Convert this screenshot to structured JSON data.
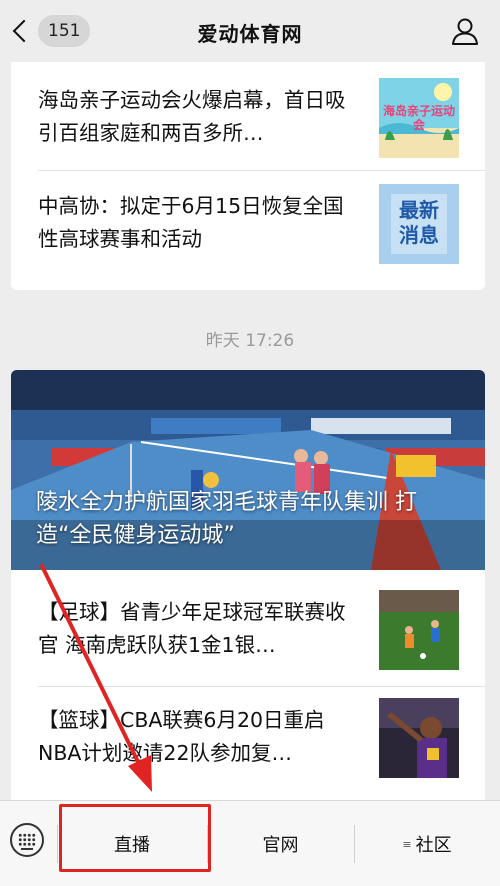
{
  "header": {
    "back_count": "151",
    "title": "爱动体育网"
  },
  "feed_top": {
    "items": [
      {
        "title": "海岛亲子运动会火爆启幕，首日吸引百组家庭和两百多所…",
        "thumb_text": "海岛亲子运动会"
      },
      {
        "title": "中高协：拟定于6月15日恢复全国性高球赛事和活动",
        "thumb_text": "最新消息"
      }
    ]
  },
  "timestamp": "昨天 17:26",
  "feed_main": {
    "hero_caption": "陵水全力护航国家羽毛球青年队集训 打造“全民健身运动城”",
    "items": [
      {
        "title": "【足球】省青少年足球冠军联赛收官 海南虎跃队获1金1银…"
      },
      {
        "title": "【篮球】CBA联赛6月20日重启 NBA计划邀请22队参加复…"
      }
    ]
  },
  "bottom_menu": {
    "items": [
      {
        "label": "直播"
      },
      {
        "label": "官网"
      },
      {
        "label": "社区",
        "icon": "≡"
      }
    ]
  },
  "colors": {
    "annotation_red": "#e02424",
    "background": "#ededed"
  }
}
